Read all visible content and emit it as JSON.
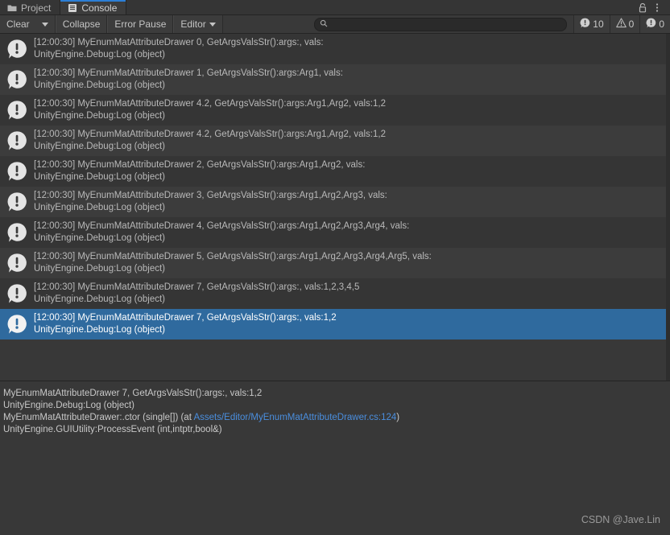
{
  "window": {
    "tabs": [
      {
        "label": "Project",
        "icon": "folder-icon",
        "active": false
      },
      {
        "label": "Console",
        "icon": "console-icon",
        "active": true
      }
    ],
    "controls": [
      {
        "name": "lock-icon"
      },
      {
        "name": "kebab-menu-icon"
      }
    ]
  },
  "toolbar": {
    "clear_label": "Clear",
    "clear_dropdown_icon": "chevron-down-icon",
    "collapse_label": "Collapse",
    "error_pause_label": "Error Pause",
    "editor_label": "Editor",
    "editor_dropdown_icon": "chevron-down-icon",
    "search": {
      "icon": "search-icon",
      "value": "",
      "placeholder": ""
    },
    "counters": [
      {
        "icon": "error-icon",
        "count": "10",
        "name": "error-count"
      },
      {
        "icon": "warning-icon",
        "count": "0",
        "name": "warning-count"
      },
      {
        "icon": "info-icon",
        "count": "0",
        "name": "info-count"
      }
    ]
  },
  "log_entries": [
    {
      "icon": "error-icon",
      "line1": "[12:00:30] MyEnumMatAttributeDrawer 0, GetArgsValsStr():args:, vals:",
      "line2": "UnityEngine.Debug:Log (object)",
      "selected": false
    },
    {
      "icon": "error-icon",
      "line1": "[12:00:30] MyEnumMatAttributeDrawer 1, GetArgsValsStr():args:Arg1, vals:",
      "line2": "UnityEngine.Debug:Log (object)",
      "selected": false
    },
    {
      "icon": "error-icon",
      "line1": "[12:00:30] MyEnumMatAttributeDrawer 4.2, GetArgsValsStr():args:Arg1,Arg2, vals:1,2",
      "line2": "UnityEngine.Debug:Log (object)",
      "selected": false
    },
    {
      "icon": "error-icon",
      "line1": "[12:00:30] MyEnumMatAttributeDrawer 4.2, GetArgsValsStr():args:Arg1,Arg2, vals:1,2",
      "line2": "UnityEngine.Debug:Log (object)",
      "selected": false
    },
    {
      "icon": "error-icon",
      "line1": "[12:00:30] MyEnumMatAttributeDrawer 2, GetArgsValsStr():args:Arg1,Arg2, vals:",
      "line2": "UnityEngine.Debug:Log (object)",
      "selected": false
    },
    {
      "icon": "error-icon",
      "line1": "[12:00:30] MyEnumMatAttributeDrawer 3, GetArgsValsStr():args:Arg1,Arg2,Arg3, vals:",
      "line2": "UnityEngine.Debug:Log (object)",
      "selected": false
    },
    {
      "icon": "error-icon",
      "line1": "[12:00:30] MyEnumMatAttributeDrawer 4, GetArgsValsStr():args:Arg1,Arg2,Arg3,Arg4, vals:",
      "line2": "UnityEngine.Debug:Log (object)",
      "selected": false
    },
    {
      "icon": "error-icon",
      "line1": "[12:00:30] MyEnumMatAttributeDrawer 5, GetArgsValsStr():args:Arg1,Arg2,Arg3,Arg4,Arg5, vals:",
      "line2": "UnityEngine.Debug:Log (object)",
      "selected": false
    },
    {
      "icon": "error-icon",
      "line1": "[12:00:30] MyEnumMatAttributeDrawer 7, GetArgsValsStr():args:, vals:1,2,3,4,5",
      "line2": "UnityEngine.Debug:Log (object)",
      "selected": false
    },
    {
      "icon": "error-icon",
      "line1": "[12:00:30] MyEnumMatAttributeDrawer 7, GetArgsValsStr():args:, vals:1,2",
      "line2": "UnityEngine.Debug:Log (object)",
      "selected": true
    }
  ],
  "detail": {
    "line1": "MyEnumMatAttributeDrawer 7, GetArgsValsStr():args:, vals:1,2",
    "line2": "UnityEngine.Debug:Log (object)",
    "line3_prefix": "MyEnumMatAttributeDrawer:.ctor (single[]) (at ",
    "line3_link": "Assets/Editor/MyEnumMatAttributeDrawer.cs:124",
    "line3_suffix": ")",
    "line4": "UnityEngine.GUIUtility:ProcessEvent (int,intptr,bool&)"
  },
  "watermark": "CSDN @Jave.Lin",
  "colors": {
    "accent_blue": "#2c7fd6",
    "selection_blue": "#2f6a9e",
    "link_blue": "#4a8ede",
    "panel_bg": "#383838",
    "row_odd": "#353535",
    "row_even": "#3c3c3c"
  }
}
